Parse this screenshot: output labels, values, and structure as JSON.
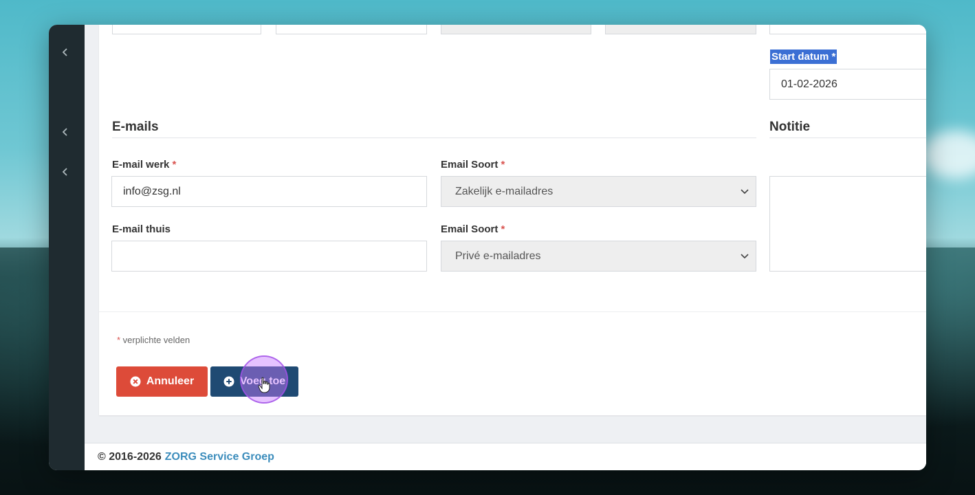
{
  "start_date": {
    "label": "Start datum",
    "required_mark": "*",
    "value": "01-02-2026"
  },
  "emails": {
    "section_title": "E-mails",
    "work": {
      "label": "E-mail werk",
      "required_mark": "*",
      "value": "info@zsg.nl"
    },
    "work_type": {
      "label": "Email Soort",
      "required_mark": "*",
      "selected": "Zakelijk e-mailadres"
    },
    "home": {
      "label": "E-mail thuis",
      "value": ""
    },
    "home_type": {
      "label": "Email Soort",
      "required_mark": "*",
      "selected": "Privé e-mailadres"
    }
  },
  "notitie": {
    "section_title": "Notitie",
    "value": ""
  },
  "required_note": {
    "mark": "*",
    "text": " verplichte velden"
  },
  "buttons": {
    "cancel": "Annuleer",
    "add": "Voeg toe"
  },
  "footer": {
    "copyright": "© 2016-2026",
    "company": "ZORG Service Groep"
  },
  "colors": {
    "sidebar": "#1f2b30",
    "cancel": "#dd4b39",
    "add": "#1f4a73",
    "link": "#3c8dbc",
    "highlight": "#3b6fd4"
  },
  "icons": {
    "sidebar": [
      "chevron-left-icon",
      "chevron-left-icon",
      "chevron-left-icon"
    ],
    "cancel": "times-circle-icon",
    "add": "plus-circle-icon",
    "select": "chevron-down-icon"
  }
}
